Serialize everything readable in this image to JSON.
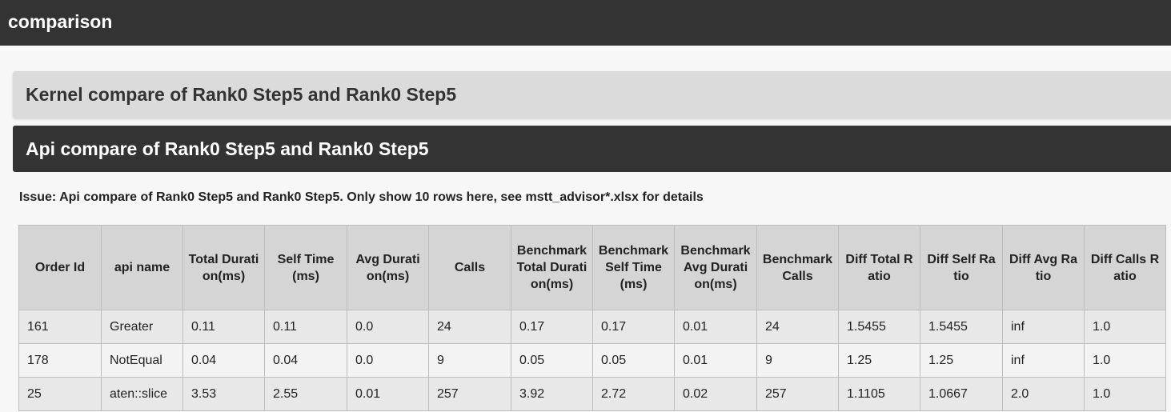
{
  "header": {
    "title": "comparison"
  },
  "sections": {
    "kernel_title": "Kernel compare of Rank0 Step5 and Rank0 Step5",
    "api_title": "Api compare of Rank0 Step5 and Rank0 Step5"
  },
  "issue": {
    "text": "Issue: Api compare of Rank0 Step5 and Rank0 Step5. Only show 10 rows here, see mstt_advisor*.xlsx for details"
  },
  "table": {
    "columns": [
      "Order Id",
      "api name",
      "Total Duration(ms)",
      "Self Time (ms)",
      "Avg Duration(ms)",
      "Calls",
      "Benchmark Total Duration(ms)",
      "Benchmark Self Time(ms)",
      "Benchmark Avg Duration(ms)",
      "Benchmark Calls",
      "Diff Total Ratio",
      "Diff Self Ratio",
      "Diff Avg Ratio",
      "Diff Calls Ratio"
    ],
    "rows": [
      [
        "161",
        "Greater",
        "0.11",
        "0.11",
        "0.0",
        "24",
        "0.17",
        "0.17",
        "0.01",
        "24",
        "1.5455",
        "1.5455",
        "inf",
        "1.0"
      ],
      [
        "178",
        "NotEqual",
        "0.04",
        "0.04",
        "0.0",
        "9",
        "0.05",
        "0.05",
        "0.01",
        "9",
        "1.25",
        "1.25",
        "inf",
        "1.0"
      ],
      [
        "25",
        "aten::slice",
        "3.53",
        "2.55",
        "0.01",
        "257",
        "3.92",
        "2.72",
        "0.02",
        "257",
        "1.1105",
        "1.0667",
        "2.0",
        "1.0"
      ]
    ]
  }
}
